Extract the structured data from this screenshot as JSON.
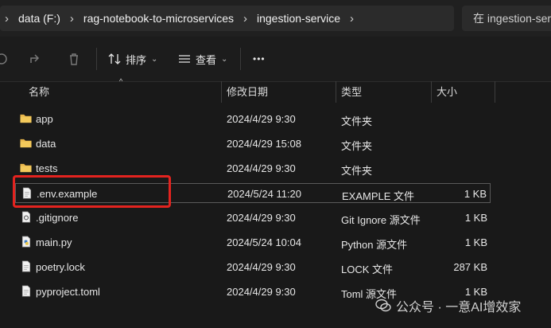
{
  "breadcrumb": {
    "items": [
      "data (F:)",
      "rag-notebook-to-microservices",
      "ingestion-service"
    ]
  },
  "search": {
    "placeholder": "在 ingestion-ser"
  },
  "toolbar": {
    "sort_label": "排序",
    "view_label": "查看",
    "more_label": "•••"
  },
  "columns": {
    "name": "名称",
    "date": "修改日期",
    "type": "类型",
    "size": "大小"
  },
  "files": [
    {
      "name": "app",
      "date": "2024/4/29 9:30",
      "type": "文件夹",
      "size": "",
      "icon": "folder-icon"
    },
    {
      "name": "data",
      "date": "2024/4/29 15:08",
      "type": "文件夹",
      "size": "",
      "icon": "folder-icon"
    },
    {
      "name": "tests",
      "date": "2024/4/29 9:30",
      "type": "文件夹",
      "size": "",
      "icon": "folder-icon"
    },
    {
      "name": ".env.example",
      "date": "2024/5/24 11:20",
      "type": "EXAMPLE 文件",
      "size": "1 KB",
      "icon": "file-icon"
    },
    {
      "name": ".gitignore",
      "date": "2024/4/29 9:30",
      "type": "Git Ignore 源文件",
      "size": "1 KB",
      "icon": "gear-file-icon"
    },
    {
      "name": "main.py",
      "date": "2024/5/24 10:04",
      "type": "Python 源文件",
      "size": "1 KB",
      "icon": "python-file-icon"
    },
    {
      "name": "poetry.lock",
      "date": "2024/4/29 9:30",
      "type": "LOCK 文件",
      "size": "287 KB",
      "icon": "file-icon"
    },
    {
      "name": "pyproject.toml",
      "date": "2024/4/29 9:30",
      "type": "Toml 源文件",
      "size": "1 KB",
      "icon": "file-icon"
    }
  ],
  "watermark": {
    "text": "公众号 · 一意AI增效家"
  },
  "colors": {
    "folder": "#e8b64c",
    "highlight": "#e3231f",
    "background": "#191919"
  }
}
